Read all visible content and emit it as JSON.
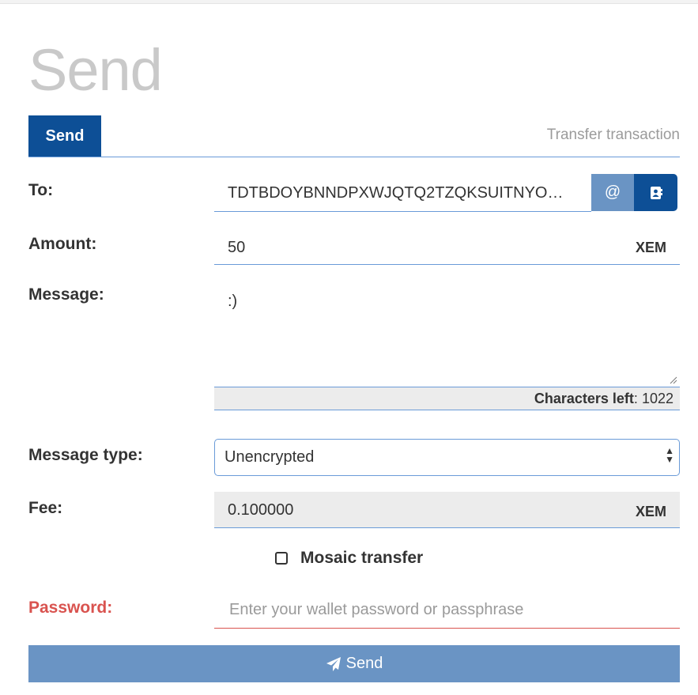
{
  "page": {
    "title": "Send"
  },
  "tabs": {
    "active_label": "Send",
    "caption": "Transfer transaction"
  },
  "form": {
    "to": {
      "label": "To:",
      "value": "TDTBDOYBNNDPXWJQTQ2TZQKSUITNYO…",
      "at_button": "@"
    },
    "amount": {
      "label": "Amount:",
      "value": "50",
      "unit": "XEM"
    },
    "message": {
      "label": "Message:",
      "value": ":)",
      "chars_left_label": "Characters left",
      "chars_left_sep": ":",
      "chars_left_value": "1022"
    },
    "message_type": {
      "label": "Message type:",
      "selected": "Unencrypted"
    },
    "fee": {
      "label": "Fee:",
      "value": "0.100000",
      "unit": "XEM"
    },
    "mosaic": {
      "label": "Mosaic transfer",
      "checked": false
    },
    "password": {
      "label": "Password:",
      "placeholder": "Enter your wallet password or passphrase",
      "value": ""
    },
    "submit": {
      "label": "Send"
    }
  },
  "colors": {
    "primary": "#0d4f96",
    "button": "#6a94c4",
    "danger": "#d9534f",
    "border": "#6a9bd8"
  },
  "icons": {
    "contacts": "address-book-icon",
    "submit": "paper-plane-icon",
    "select": "select-arrows-icon"
  }
}
